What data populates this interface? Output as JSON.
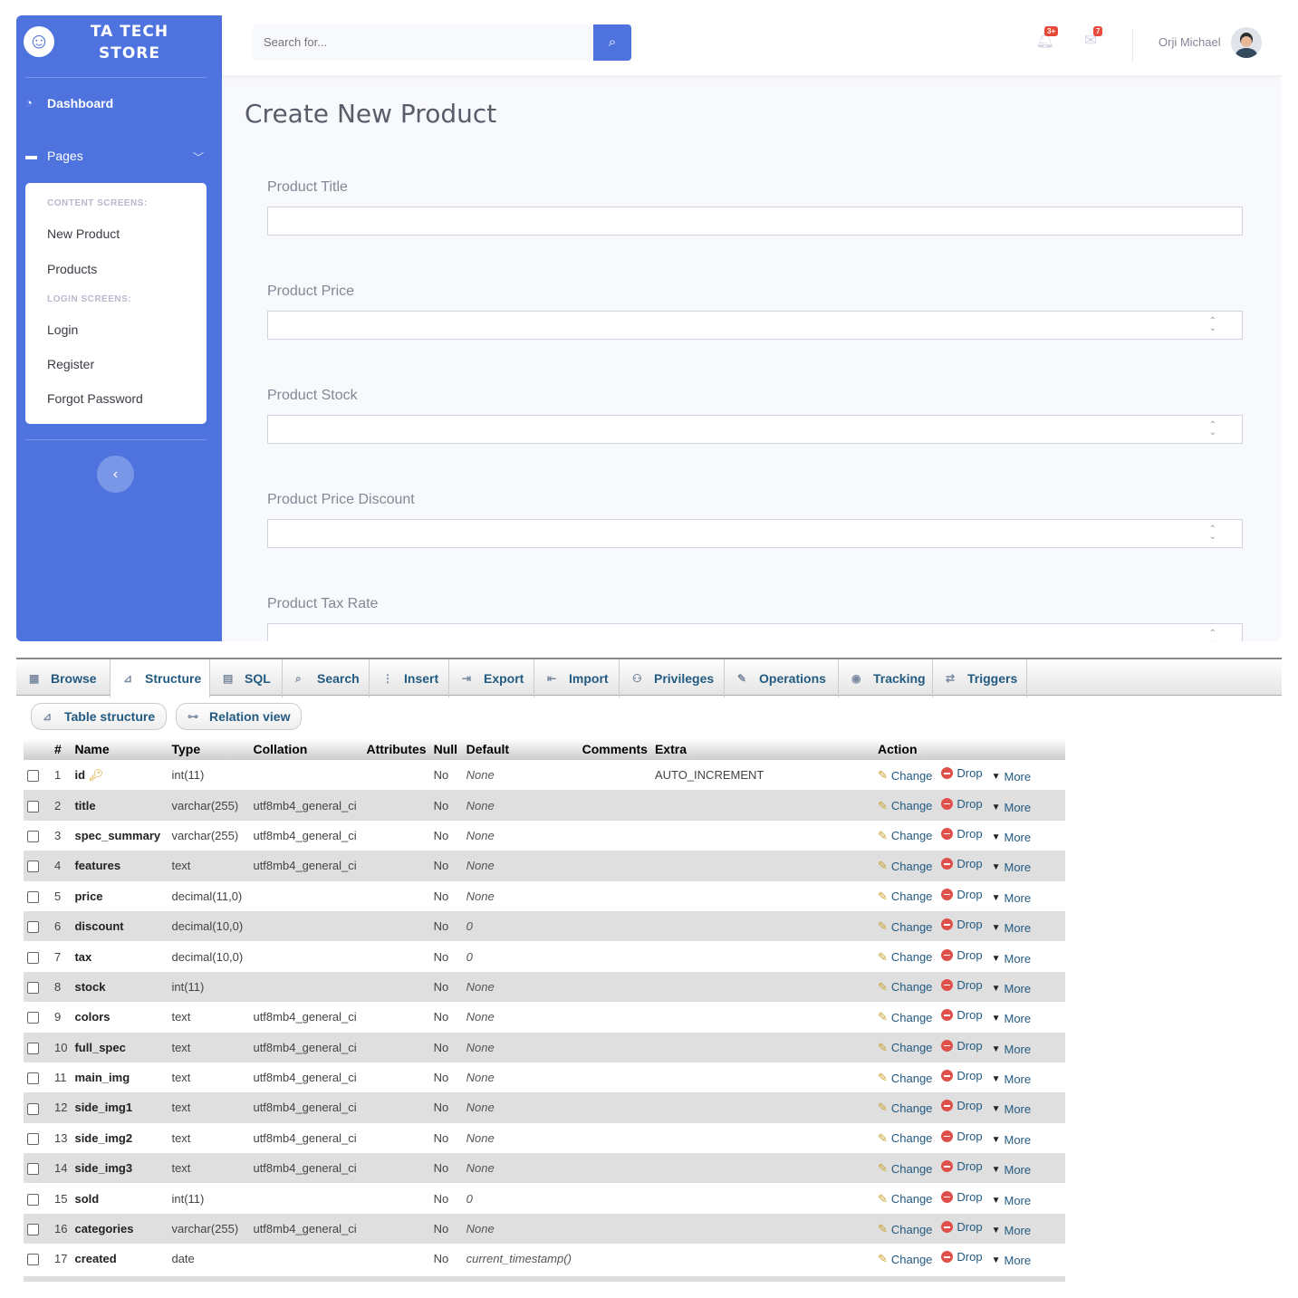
{
  "brand": {
    "line1": "TA TECH",
    "line2": "STORE",
    "logo": "laugh-icon"
  },
  "sidebar": {
    "dashboard": "Dashboard",
    "pages": "Pages",
    "content_header": "CONTENT SCREENS:",
    "content_items": [
      "New Product",
      "Products"
    ],
    "login_header": "LOGIN SCREENS:",
    "login_items": [
      "Login",
      "Register",
      "Forgot Password"
    ],
    "toggle": "‹"
  },
  "topbar": {
    "search_placeholder": "Search for...",
    "alerts_badge": "3+",
    "messages_badge": "7",
    "user_name": "Orji Michael"
  },
  "page": {
    "title": "Create New Product",
    "fields": [
      "Product Title",
      "Product Price",
      "Product Stock",
      "Product Price Discount",
      "Product Tax Rate"
    ]
  },
  "pma": {
    "tabs": [
      "Browse",
      "Structure",
      "SQL",
      "Search",
      "Insert",
      "Export",
      "Import",
      "Privileges",
      "Operations",
      "Tracking",
      "Triggers"
    ],
    "active_tab": "Structure",
    "subtabs": [
      "Table structure",
      "Relation view"
    ],
    "columns": [
      "#",
      "Name",
      "Type",
      "Collation",
      "Attributes",
      "Null",
      "Default",
      "Comments",
      "Extra",
      "Action"
    ],
    "actions": {
      "change": "Change",
      "drop": "Drop",
      "more": "More"
    },
    "rows": [
      {
        "n": "1",
        "name": "id",
        "type": "int(11)",
        "collation": "",
        "null": "No",
        "default": "None",
        "extra": "AUTO_INCREMENT",
        "key": true
      },
      {
        "n": "2",
        "name": "title",
        "type": "varchar(255)",
        "collation": "utf8mb4_general_ci",
        "null": "No",
        "default": "None",
        "extra": ""
      },
      {
        "n": "3",
        "name": "spec_summary",
        "type": "varchar(255)",
        "collation": "utf8mb4_general_ci",
        "null": "No",
        "default": "None",
        "extra": ""
      },
      {
        "n": "4",
        "name": "features",
        "type": "text",
        "collation": "utf8mb4_general_ci",
        "null": "No",
        "default": "None",
        "extra": ""
      },
      {
        "n": "5",
        "name": "price",
        "type": "decimal(11,0)",
        "collation": "",
        "null": "No",
        "default": "None",
        "extra": ""
      },
      {
        "n": "6",
        "name": "discount",
        "type": "decimal(10,0)",
        "collation": "",
        "null": "No",
        "default": "0",
        "extra": ""
      },
      {
        "n": "7",
        "name": "tax",
        "type": "decimal(10,0)",
        "collation": "",
        "null": "No",
        "default": "0",
        "extra": ""
      },
      {
        "n": "8",
        "name": "stock",
        "type": "int(11)",
        "collation": "",
        "null": "No",
        "default": "None",
        "extra": ""
      },
      {
        "n": "9",
        "name": "colors",
        "type": "text",
        "collation": "utf8mb4_general_ci",
        "null": "No",
        "default": "None",
        "extra": ""
      },
      {
        "n": "10",
        "name": "full_spec",
        "type": "text",
        "collation": "utf8mb4_general_ci",
        "null": "No",
        "default": "None",
        "extra": ""
      },
      {
        "n": "11",
        "name": "main_img",
        "type": "text",
        "collation": "utf8mb4_general_ci",
        "null": "No",
        "default": "None",
        "extra": ""
      },
      {
        "n": "12",
        "name": "side_img1",
        "type": "text",
        "collation": "utf8mb4_general_ci",
        "null": "No",
        "default": "None",
        "extra": ""
      },
      {
        "n": "13",
        "name": "side_img2",
        "type": "text",
        "collation": "utf8mb4_general_ci",
        "null": "No",
        "default": "None",
        "extra": ""
      },
      {
        "n": "14",
        "name": "side_img3",
        "type": "text",
        "collation": "utf8mb4_general_ci",
        "null": "No",
        "default": "None",
        "extra": ""
      },
      {
        "n": "15",
        "name": "sold",
        "type": "int(11)",
        "collation": "",
        "null": "No",
        "default": "0",
        "extra": ""
      },
      {
        "n": "16",
        "name": "categories",
        "type": "varchar(255)",
        "collation": "utf8mb4_general_ci",
        "null": "No",
        "default": "None",
        "extra": ""
      },
      {
        "n": "17",
        "name": "created",
        "type": "date",
        "collation": "",
        "null": "No",
        "default": "current_timestamp()",
        "extra": ""
      }
    ]
  },
  "colors": {
    "primary": "#4e73df",
    "pma_link": "#235a81",
    "danger": "#e74a3b"
  }
}
